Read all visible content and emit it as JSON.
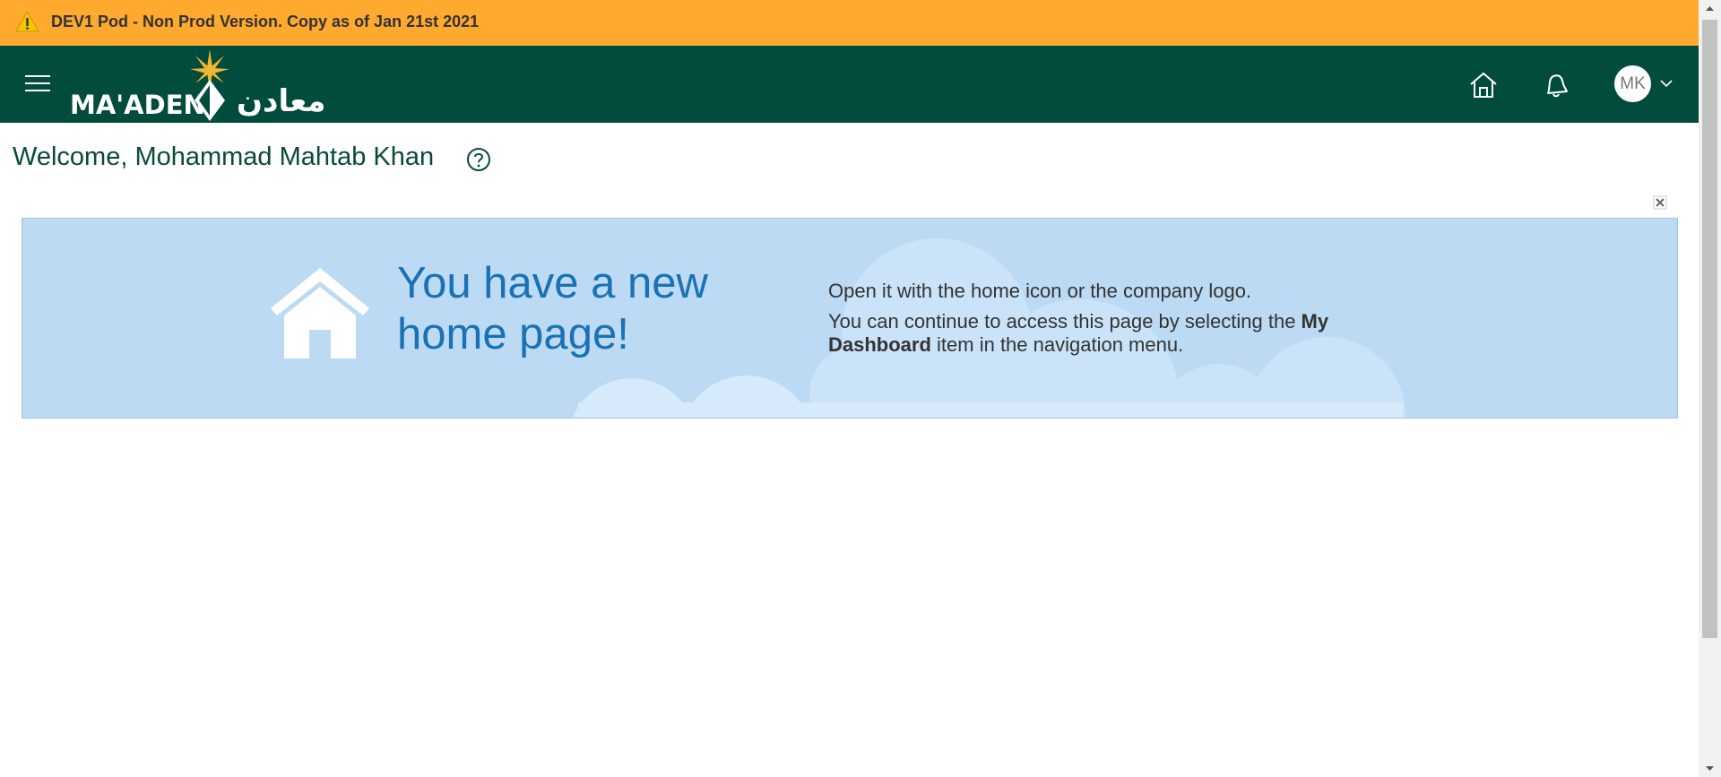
{
  "warning": {
    "text": "DEV1 Pod - Non Prod Version. Copy as of Jan 21st 2021",
    "icon": "warning-triangle-icon"
  },
  "header": {
    "logo_en": "MA'ADEN",
    "logo_ar": "معادن",
    "avatar_initials": "MK",
    "background_color": "#024c3d"
  },
  "welcome": {
    "text": "Welcome, Mohammad Mahtab Khan"
  },
  "banner": {
    "title": "You have a new home page!",
    "line1": "Open it with the home icon or the company logo.",
    "line2_prefix": "You can continue to access this page by selecting the ",
    "line2_bold": "My Dashboard",
    "line2_suffix": " item in the navigation menu.",
    "background_color": "#bcdaf3",
    "title_color": "#1a72b5"
  },
  "colors": {
    "warning_bar": "#ffa92f",
    "welcome_text": "#0a4a3c"
  }
}
